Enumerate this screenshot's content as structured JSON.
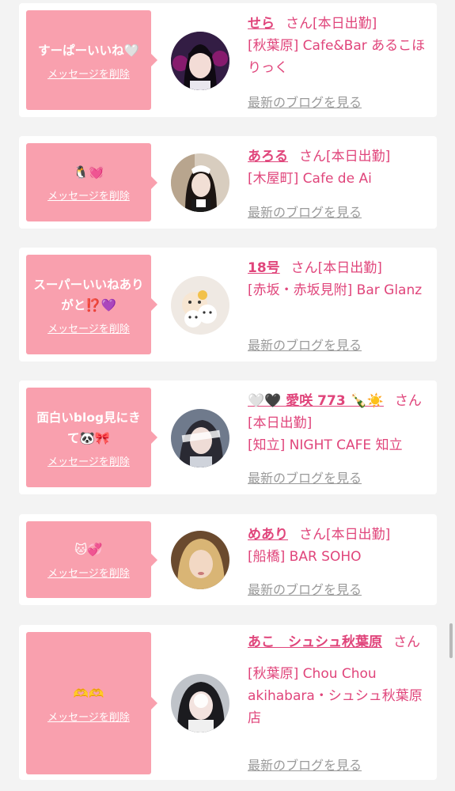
{
  "cards": [
    {
      "message": "すーぱーいいね🤍",
      "delete_label": "メッセージを削除",
      "name": "せら",
      "san": "さん",
      "status": "[本日出勤]",
      "shop": "[秋葉原] Cafe&Bar あるこほりっく",
      "blog_label": "最新のブログを見る"
    },
    {
      "message": "🐧💓",
      "delete_label": "メッセージを削除",
      "name": "あろる",
      "san": "さん",
      "status": "[本日出勤]",
      "shop": "[木屋町] Cafe de Ai",
      "blog_label": "最新のブログを見る"
    },
    {
      "message": "スーパーいいねありがと⁉️💜",
      "delete_label": "メッセージを削除",
      "name": "18号",
      "san": "さん",
      "status": "[本日出勤]",
      "shop": "[赤坂・赤坂見附] Bar Glanz",
      "blog_label": "最新のブログを見る"
    },
    {
      "message": "面白いblog見にきて🐼🎀",
      "delete_label": "メッセージを削除",
      "name": "🤍🖤 愛咲 773 🍾☀️",
      "san": "さん",
      "status": "[本日出勤]",
      "shop": "[知立] NIGHT CAFE 知立",
      "blog_label": "最新のブログを見る"
    },
    {
      "message": "🐱💞",
      "delete_label": "メッセージを削除",
      "name": "めあり",
      "san": "さん",
      "status": "[本日出勤]",
      "shop": "[船橋] BAR SOHO",
      "blog_label": "最新のブログを見る"
    },
    {
      "message": "🫶🫶",
      "delete_label": "メッセージを削除",
      "name": "あこ　シュシュ秋葉原",
      "san": "さん",
      "status": "",
      "shop": "[秋葉原] Chou Chou akihabara・シュシュ秋葉原店",
      "blog_label": "最新のブログを見る"
    }
  ],
  "colors": {
    "accent": "#e0457b",
    "bubble": "#f9a0ae",
    "link_gray": "#9a9a9a",
    "background": "#f3f3f3"
  }
}
